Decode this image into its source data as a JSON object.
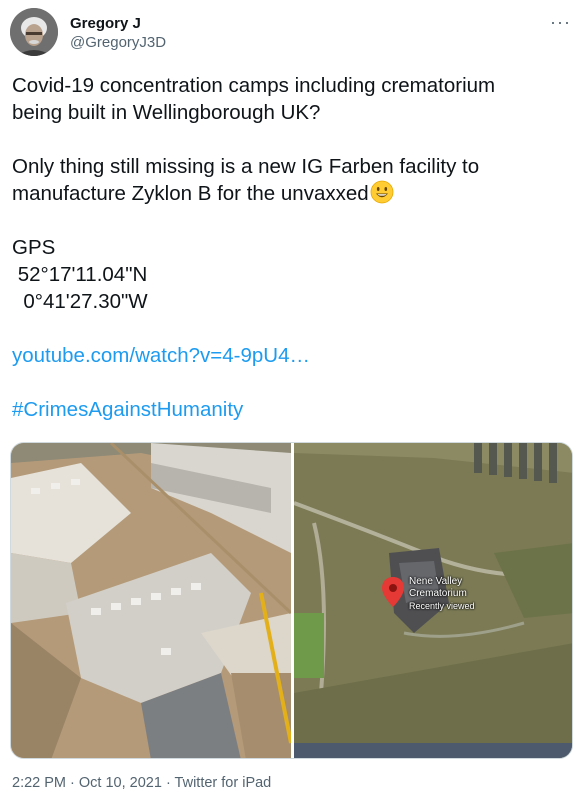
{
  "author": {
    "display_name": "Gregory J",
    "handle": "@GregoryJ3D",
    "avatar_icon": "portrait-avatar"
  },
  "menu": {
    "more_label": "···",
    "icon": "more-horizontal-icon"
  },
  "tweet": {
    "line1a": "Covid-19 concentration camps including crematorium",
    "line1b": "being built in Wellingborough UK?",
    "line2a": "Only thing still missing is a new IG Farben facility to",
    "line2b": "manufacture Zyklon B for the unvaxxed",
    "emoji": "grinning-face-emoji",
    "gps_label": "GPS",
    "gps_lat": "52°17'11.04\"N",
    "gps_lon": "0°41'27.30\"W",
    "link": "youtube.com/watch?v=4-9pU4…",
    "hashtag": "#CrimesAgainstHumanity"
  },
  "media": {
    "left_photo": "aerial-construction-site-photo",
    "right_photo": {
      "kind": "satellite-map-photo",
      "place_title_line1": "Nene Valley",
      "place_title_line2": "Crematorium",
      "place_subtitle": "Recently viewed",
      "pin_icon": "map-pin-icon",
      "pin_color": "#e53935"
    }
  },
  "footer": {
    "time": "2:22 PM",
    "sep1": " · ",
    "date": "Oct 10, 2021",
    "sep2": " · ",
    "source": "Twitter for iPad"
  },
  "colors": {
    "link": "#1d9bf0",
    "text": "#0f1419",
    "muted": "#536471"
  }
}
